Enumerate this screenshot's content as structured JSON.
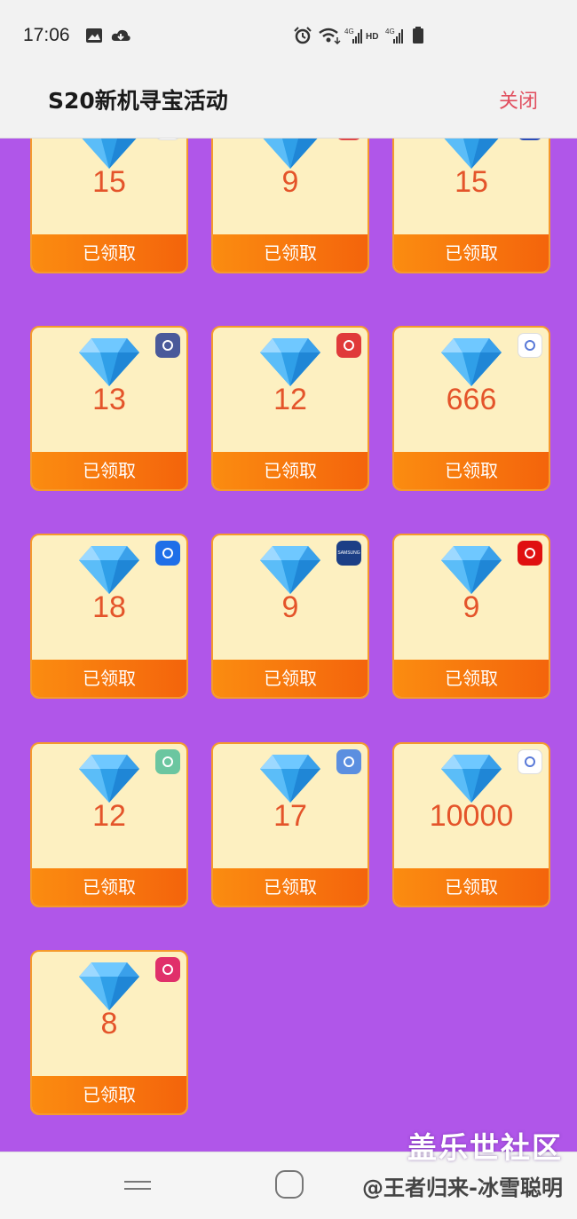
{
  "status_bar": {
    "time": "17:06",
    "icons": [
      "image-icon",
      "cloud-icon",
      "alarm-icon",
      "wifi-icon",
      "signal-4g-icon",
      "hd-icon",
      "signal-4g-icon-2",
      "battery-icon"
    ]
  },
  "header": {
    "title": "S20新机寻宝活动",
    "close_label": "关闭"
  },
  "colors": {
    "page_background": "#b056e9",
    "card_background": "#fdf0c1",
    "card_border": "#f59a2c",
    "value_text": "#e4542a",
    "footer_gradient_start": "#fb8c10",
    "footer_gradient_end": "#f4640c",
    "close_text": "#e14f5f"
  },
  "cards": [
    {
      "value": "15",
      "status": "已领取",
      "badge_icon": "browser-icon",
      "badge_color": "#ffffff"
    },
    {
      "value": "9",
      "status": "已领取",
      "badge_icon": "red-app-icon",
      "badge_color": "#e04848"
    },
    {
      "value": "15",
      "status": "已领取",
      "badge_icon": "samsung-pay-icon",
      "badge_color": "#2a4bb8"
    },
    {
      "value": "13",
      "status": "已领取",
      "badge_icon": "bixby-icon",
      "badge_color": "#4a5a9a"
    },
    {
      "value": "12",
      "status": "已领取",
      "badge_icon": "book-icon",
      "badge_color": "#e03a3a"
    },
    {
      "value": "666",
      "status": "已领取",
      "badge_icon": "smartthings-icon",
      "badge_color": "#ffffff"
    },
    {
      "value": "18",
      "status": "已领取",
      "badge_icon": "samsung-members-icon",
      "badge_color": "#1f6fe8"
    },
    {
      "value": "9",
      "status": "已领取",
      "badge_icon": "samsung-store-icon",
      "badge_color": "#1c3f86",
      "badge_text": "SAMSUNG"
    },
    {
      "value": "9",
      "status": "已领取",
      "badge_icon": "headphones-icon",
      "badge_color": "#e01010"
    },
    {
      "value": "12",
      "status": "已领取",
      "badge_icon": "health-icon",
      "badge_color": "#6bc6a0"
    },
    {
      "value": "17",
      "status": "已领取",
      "badge_icon": "smart-switch-icon",
      "badge_color": "#5b8fe0"
    },
    {
      "value": "10000",
      "status": "已领取",
      "badge_icon": "internet-icon",
      "badge_color": "#ffffff"
    },
    {
      "value": "8",
      "status": "已领取",
      "badge_icon": "galaxy-store-icon",
      "badge_color": "#e0306a"
    }
  ],
  "bottom_bar": {
    "watermark_site": "盖乐世社区",
    "watermark_author": "@王者归来-冰雪聪明"
  }
}
